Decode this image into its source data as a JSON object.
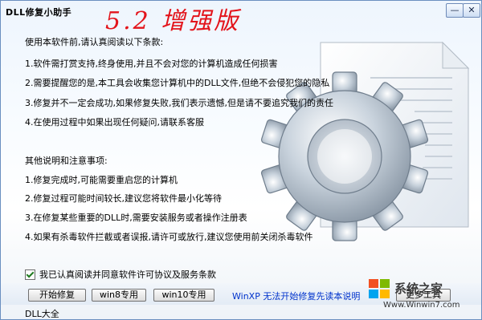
{
  "window": {
    "app_title": "DLL修复小助手",
    "version_label": "5.2 增强版",
    "minimize_label": "—",
    "close_label": "✕"
  },
  "terms": {
    "heading": "使用本软件前,请认真阅读以下条款:",
    "items": [
      "1.软件需打赏支持,终身使用,并且不会对您的计算机造成任何损害",
      "2.需要提醒您的是,本工具会收集您计算机中的DLL文件,但绝不会侵犯您的隐私",
      "3.修复并不一定会成功,如果修复失败,我们表示遗憾,但是请不要追究我们的责任",
      "4.在使用过程中如果出现任何疑问,请联系客服"
    ]
  },
  "notes": {
    "heading": "其他说明和注意事项:",
    "items": [
      "1.修复完成时,可能需要重启您的计算机",
      "2.修复过程可能时间较长,建议您将软件最小化等待",
      "3.在修复某些重要的DLL时,需要安装服务或者操作注册表",
      "4.如果有杀毒软件拦截或者误报,请许可或放行,建议您使用前关闭杀毒软件"
    ]
  },
  "agreement": {
    "checked": true,
    "label": "我已认真阅读并同意软件许可协议及服务条款"
  },
  "toolbar": {
    "start_label": "开始修复",
    "win8_label": "win8专用",
    "win10_label": "win10专用",
    "status_text": "WinXP 无法开始修复先读本说明",
    "more_label": "更多工具"
  },
  "watermark": {
    "brand": "Win7",
    "site": "系统之家",
    "url": "Www.Winwin7.com"
  },
  "footer": {
    "label": "DLL大全"
  }
}
